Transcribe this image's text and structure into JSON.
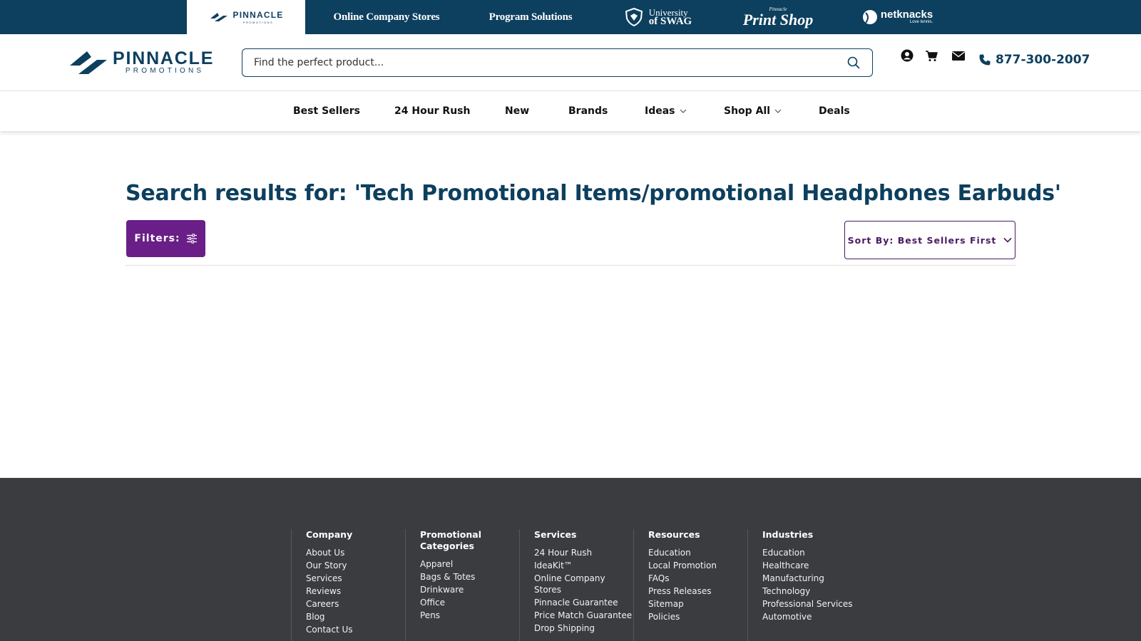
{
  "brand_bar": {
    "tabs": [
      {
        "label": "PINNACLE",
        "sublabel": "PROMOTIONS",
        "active": true
      },
      {
        "label": "Online Company Stores"
      },
      {
        "label": "Program Solutions"
      },
      {
        "label_line1": "University",
        "label_line2": "of SWAG"
      },
      {
        "label_small": "Pinnacle",
        "label_big": "Print Shop"
      },
      {
        "label": "netknacks",
        "tagline": "Love tennis."
      }
    ]
  },
  "header": {
    "logo": {
      "line1": "PINNACLE",
      "line2": "PROMOTIONS"
    },
    "search": {
      "placeholder": "Find the perfect product...",
      "value": ""
    },
    "icons": [
      "user-icon",
      "cart-icon",
      "mail-icon",
      "phone-icon"
    ],
    "phone": "877-300-2007"
  },
  "nav": {
    "items": [
      {
        "label": "Best Sellers"
      },
      {
        "label": "24 Hour Rush"
      },
      {
        "label": "New"
      },
      {
        "label": "Brands"
      },
      {
        "label": "Ideas",
        "dropdown": true
      },
      {
        "label": "Shop All",
        "dropdown": true
      },
      {
        "label": "Deals"
      }
    ]
  },
  "main": {
    "title": "Search results for: 'Tech Promotional Items/promotional Headphones Earbuds'",
    "filters_label": "Filters:",
    "sort_label": "Sort By: Best Sellers First"
  },
  "footer": {
    "columns": [
      {
        "heading": "Company",
        "links": [
          "About Us",
          "Our Story",
          "Services",
          "Reviews",
          "Careers",
          "Blog",
          "Contact Us"
        ]
      },
      {
        "heading": "Promotional Categories",
        "links": [
          "Apparel",
          "Bags & Totes",
          "Drinkware",
          "Office",
          "Pens"
        ]
      },
      {
        "heading": "Services",
        "links": [
          "24 Hour Rush",
          "IdeaKit™",
          "Online Company Stores",
          "Pinnacle Guarantee",
          "Price Match Guarantee",
          "Drop Shipping"
        ]
      },
      {
        "heading": "Resources",
        "links": [
          "Education",
          "Local Promotion",
          "FAQs",
          "Press Releases",
          "Sitemap",
          "Policies"
        ]
      },
      {
        "heading": "Industries",
        "links": [
          "Education",
          "Healthcare",
          "Manufacturing",
          "Technology",
          "Professional Services",
          "Automotive"
        ]
      }
    ]
  },
  "colors": {
    "brand_navy": "#0d3f5e",
    "filter_purple": "#6a1e87",
    "sort_purple": "#4a1a63",
    "footer_bg": "#3a3c40"
  }
}
